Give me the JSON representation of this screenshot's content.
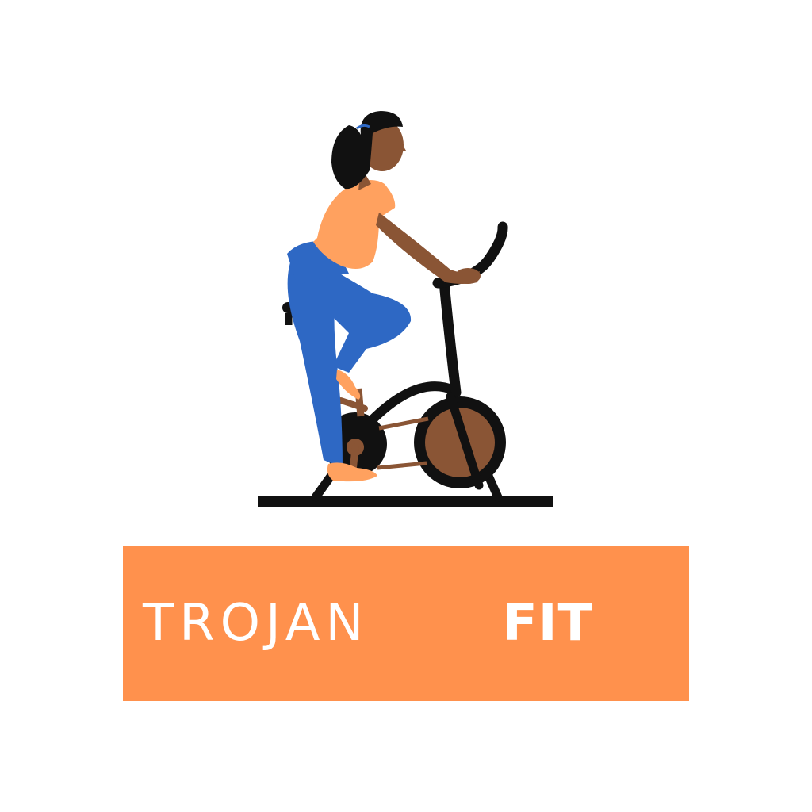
{
  "logo": {
    "word_light": "TROJAN",
    "word_bold": "FIT",
    "banner_color": "#ff914d",
    "text_color": "#ffffff",
    "background_color": "#ffffff"
  },
  "illustration": {
    "subject": "woman-on-exercise-bike",
    "colors": {
      "skin": "#8a5535",
      "hair": "#111111",
      "shirt": "#ffa15f",
      "pants": "#2e68c4",
      "shoe": "#ffa15f",
      "bike": "#111111",
      "flywheel": "#8a5535",
      "floor": "#111111"
    }
  }
}
